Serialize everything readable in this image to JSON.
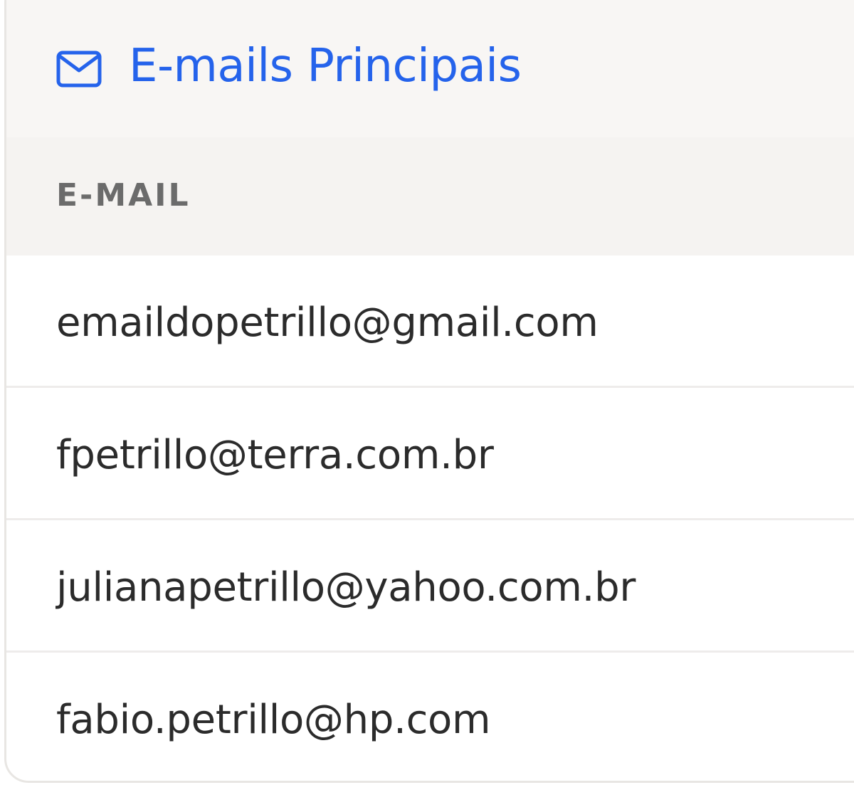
{
  "card": {
    "title": "E-mails Principais",
    "icon": "mail-icon",
    "accent_color": "#2563eb"
  },
  "table": {
    "column_header": "E-MAIL",
    "rows": [
      {
        "email": "emaildopetrillo@gmail.com"
      },
      {
        "email": "fpetrillo@terra.com.br"
      },
      {
        "email": "julianapetrillo@yahoo.com.br"
      },
      {
        "email": "fabio.petrillo@hp.com"
      }
    ]
  }
}
